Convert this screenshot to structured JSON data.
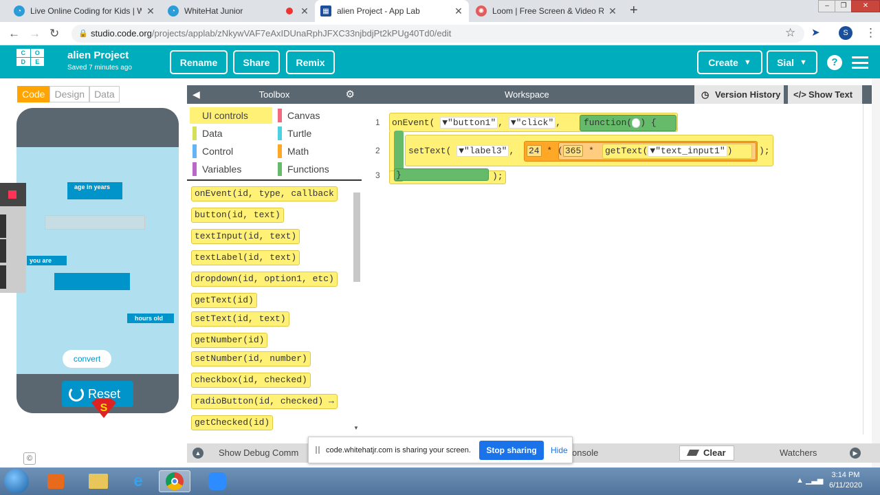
{
  "browser": {
    "tabs": [
      {
        "title": "Live Online Coding for Kids | Whi",
        "icon_color": "#2a9dd8"
      },
      {
        "title": "WhiteHat Junior",
        "icon_color": "#2a9dd8"
      },
      {
        "title": "alien Project - App Lab",
        "icon_color": "#1a4f9c"
      },
      {
        "title": "Loom | Free Screen & Video Reco",
        "icon_color": "#e35b5b"
      }
    ],
    "close_glyph": "✕",
    "newtab_glyph": "+",
    "url_host": "studio.code.org",
    "url_path": "/projects/applab/zNkywVAF7eAxIDUnaRphJFXC33njbdjPt2kPUg40Td0/edit",
    "profile_letter": "S"
  },
  "header": {
    "logo_letters": [
      "C",
      "O",
      "D",
      "E",
      "",
      ""
    ],
    "project_name": "alien Project",
    "saved_status": "Saved 7 minutes ago",
    "buttons": {
      "rename": "Rename",
      "share": "Share",
      "remix": "Remix",
      "create": "Create",
      "user": "Sial"
    },
    "help": "?"
  },
  "left": {
    "mode_tabs": [
      "Code",
      "Design",
      "Data"
    ],
    "app_screen": {
      "label_age": "age in years",
      "label_you_are": "you are",
      "label_hours_old": "hours old",
      "convert_button": "convert"
    },
    "reset_button": "Reset",
    "copyright": "©"
  },
  "toolbox": {
    "title": "Toolbox",
    "categories": [
      {
        "label": "UI controls",
        "color": "#fff176",
        "selected": true
      },
      {
        "label": "Canvas",
        "color": "#f16a7e"
      },
      {
        "label": "Data",
        "color": "#d4e157"
      },
      {
        "label": "Turtle",
        "color": "#4dd0e1"
      },
      {
        "label": "Control",
        "color": "#64b5f6"
      },
      {
        "label": "Math",
        "color": "#ffa726"
      },
      {
        "label": "Variables",
        "color": "#ba68c8"
      },
      {
        "label": "Functions",
        "color": "#66bb6a"
      }
    ],
    "blocks": [
      "onEvent(id, type, callback",
      "button(id, text)",
      "textInput(id, text)",
      "textLabel(id, text)",
      "dropdown(id, option1, etc)",
      "getText(id)",
      "setText(id, text)",
      "getNumber(id)",
      "setNumber(id, number)",
      "checkbox(id, checked)",
      "radioButton(id, checked) →",
      "getChecked(id)"
    ]
  },
  "workspace": {
    "title": "Workspace",
    "version_history": "Version History",
    "show_text": "Show Text",
    "line_numbers": [
      "1",
      "2",
      "3"
    ],
    "code": {
      "l1_onevent": "onEvent(",
      "l1_id": "▼\"button1\"",
      "l1_comma1": ",",
      "l1_type": "▼\"click\"",
      "l1_comma2": ",",
      "l1_function": "function(",
      "l1_end": ") {",
      "l2_settext": "setText(",
      "l2_id": "▼\"label3\"",
      "l2_comma": ",",
      "l2_num": "24",
      "l2_times1": "*",
      "l2_paren": "(",
      "l2_num2": "365",
      "l2_times2": "*",
      "l2_gettext": "getText(",
      "l2_arg": "▼\"text_input1\"",
      "l2_close": ")",
      "l2_end": ");",
      "l3_brace": "}",
      "l3_end": ");"
    }
  },
  "debug": {
    "show_debug": "Show Debug Comm",
    "console": "onsole",
    "clear": "Clear",
    "watchers": "Watchers"
  },
  "share_popup": {
    "message": "code.whitehatjr.com is sharing your screen.",
    "stop": "Stop sharing",
    "hide": "Hide"
  },
  "taskbar": {
    "time": "3:14 PM",
    "date": "6/11/2020"
  }
}
